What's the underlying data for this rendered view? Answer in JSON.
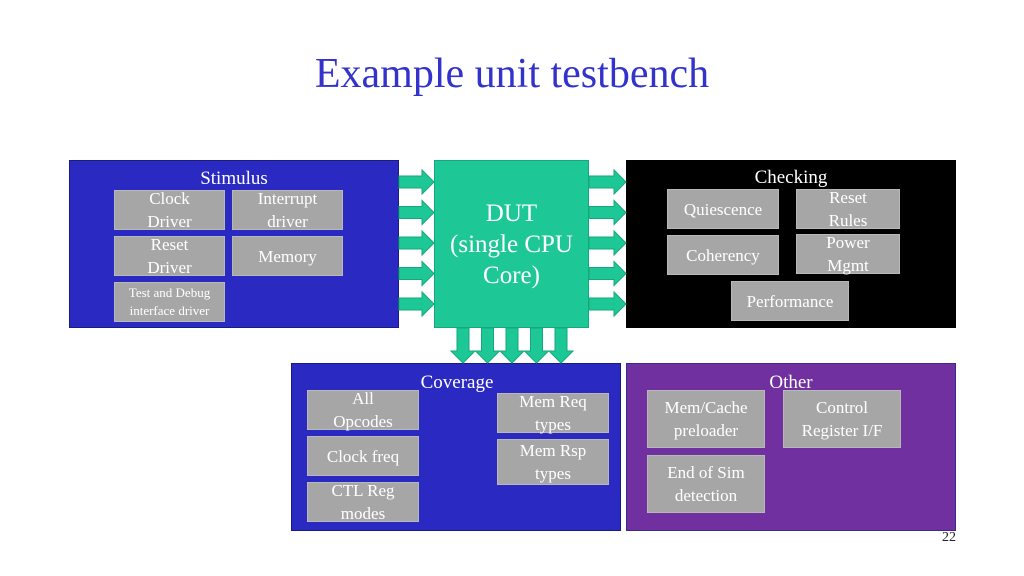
{
  "title": "Example unit testbench",
  "colors": {
    "title": "#3333cc",
    "stimulus_bg": "#2a2ac2",
    "checking_bg": "#000000",
    "coverage_bg": "#2a2ac2",
    "other_bg": "#7030a0",
    "dut_bg": "#1ec896",
    "box_bg": "#a6a6a6"
  },
  "dut": {
    "label": "DUT\n(single CPU\nCore)"
  },
  "stimulus": {
    "title": "Stimulus",
    "items": [
      "Clock\nDriver",
      "Interrupt\ndriver",
      "Reset\nDriver",
      "Memory",
      "Test and Debug\ninterface driver"
    ]
  },
  "checking": {
    "title": "Checking",
    "items": [
      "Quiescence",
      "Reset\nRules",
      "Coherency",
      "Power\nMgmt",
      "Performance"
    ]
  },
  "coverage": {
    "title": "Coverage",
    "items": [
      "All\nOpcodes",
      "Clock freq",
      "CTL Reg\nmodes",
      "Mem Req\ntypes",
      "Mem Rsp\ntypes"
    ]
  },
  "other": {
    "title": "Other",
    "items": [
      "Mem/Cache\npreloader",
      "Control\nRegister I/F",
      "End of Sim\ndetection"
    ]
  },
  "arrows": {
    "stimulus_to_dut": 5,
    "dut_to_checking": 5,
    "dut_to_coverage": 5
  },
  "page_number": "22"
}
